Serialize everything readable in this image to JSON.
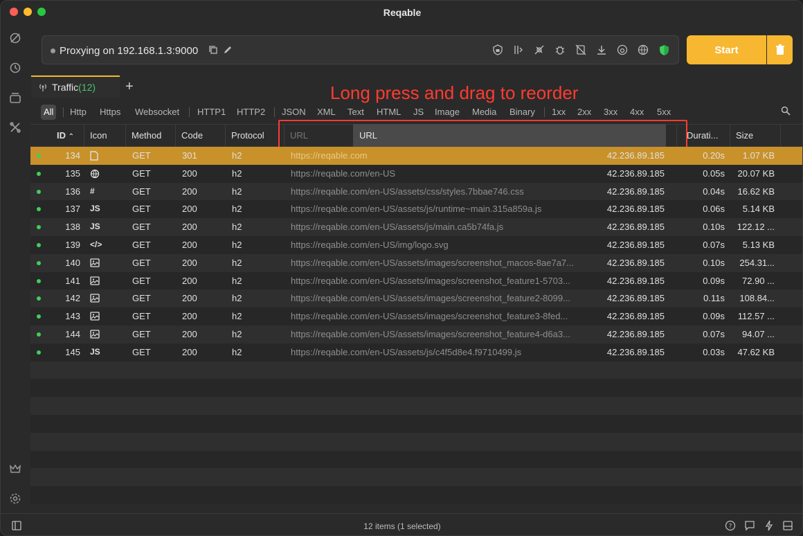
{
  "window": {
    "title": "Reqable"
  },
  "sidebar": {
    "icons": [
      "capture-icon",
      "history-icon",
      "collections-icon",
      "tools-icon",
      "crown-icon",
      "settings-icon"
    ]
  },
  "proxy": {
    "status_text": "Proxying on 192.168.1.3:9000",
    "start_label": "Start"
  },
  "tabs": [
    {
      "label": "Traffic",
      "count": "(12)"
    }
  ],
  "annotation": "Long press and drag to reorder",
  "filters": [
    "All",
    "Http",
    "Https",
    "Websocket",
    "HTTP1",
    "HTTP2",
    "JSON",
    "XML",
    "Text",
    "HTML",
    "JS",
    "Image",
    "Media",
    "Binary",
    "1xx",
    "2xx",
    "3xx",
    "4xx",
    "5xx"
  ],
  "columns": {
    "id": "ID",
    "icon": "Icon",
    "method": "Method",
    "code": "Code",
    "protocol": "Protocol",
    "url": "URL",
    "url_drag": "URL",
    "duration": "Durati...",
    "size": "Size"
  },
  "rows": [
    {
      "id": "134",
      "icon": "document",
      "method": "GET",
      "code": "301",
      "protocol": "h2",
      "url": "https://reqable.com",
      "host": "42.236.89.185",
      "duration": "0.20s",
      "size": "1.07 KB"
    },
    {
      "id": "135",
      "icon": "globe",
      "method": "GET",
      "code": "200",
      "protocol": "h2",
      "url": "https://reqable.com/en-US",
      "host": "42.236.89.185",
      "duration": "0.05s",
      "size": "20.07 KB"
    },
    {
      "id": "136",
      "icon": "#",
      "method": "GET",
      "code": "200",
      "protocol": "h2",
      "url": "https://reqable.com/en-US/assets/css/styles.7bbae746.css",
      "host": "42.236.89.185",
      "duration": "0.04s",
      "size": "16.62 KB"
    },
    {
      "id": "137",
      "icon": "JS",
      "method": "GET",
      "code": "200",
      "protocol": "h2",
      "url": "https://reqable.com/en-US/assets/js/runtime~main.315a859a.js",
      "host": "42.236.89.185",
      "duration": "0.06s",
      "size": "5.14 KB"
    },
    {
      "id": "138",
      "icon": "JS",
      "method": "GET",
      "code": "200",
      "protocol": "h2",
      "url": "https://reqable.com/en-US/assets/js/main.ca5b74fa.js",
      "host": "42.236.89.185",
      "duration": "0.10s",
      "size": "122.12 ..."
    },
    {
      "id": "139",
      "icon": "</>",
      "method": "GET",
      "code": "200",
      "protocol": "h2",
      "url": "https://reqable.com/en-US/img/logo.svg",
      "host": "42.236.89.185",
      "duration": "0.07s",
      "size": "5.13 KB"
    },
    {
      "id": "140",
      "icon": "image",
      "method": "GET",
      "code": "200",
      "protocol": "h2",
      "url": "https://reqable.com/en-US/assets/images/screenshot_macos-8ae7a7...",
      "host": "42.236.89.185",
      "duration": "0.10s",
      "size": "254.31..."
    },
    {
      "id": "141",
      "icon": "image",
      "method": "GET",
      "code": "200",
      "protocol": "h2",
      "url": "https://reqable.com/en-US/assets/images/screenshot_feature1-5703...",
      "host": "42.236.89.185",
      "duration": "0.09s",
      "size": "72.90 ..."
    },
    {
      "id": "142",
      "icon": "image",
      "method": "GET",
      "code": "200",
      "protocol": "h2",
      "url": "https://reqable.com/en-US/assets/images/screenshot_feature2-8099...",
      "host": "42.236.89.185",
      "duration": "0.11s",
      "size": "108.84..."
    },
    {
      "id": "143",
      "icon": "image",
      "method": "GET",
      "code": "200",
      "protocol": "h2",
      "url": "https://reqable.com/en-US/assets/images/screenshot_feature3-8fed...",
      "host": "42.236.89.185",
      "duration": "0.09s",
      "size": "112.57 ..."
    },
    {
      "id": "144",
      "icon": "image",
      "method": "GET",
      "code": "200",
      "protocol": "h2",
      "url": "https://reqable.com/en-US/assets/images/screenshot_feature4-d6a3...",
      "host": "42.236.89.185",
      "duration": "0.07s",
      "size": "94.07 ..."
    },
    {
      "id": "145",
      "icon": "JS",
      "method": "GET",
      "code": "200",
      "protocol": "h2",
      "url": "https://reqable.com/en-US/assets/js/c4f5d8e4.f9710499.js",
      "host": "42.236.89.185",
      "duration": "0.03s",
      "size": "47.62 KB"
    }
  ],
  "selected_row": "134",
  "status": {
    "text": "12 items (1 selected)"
  },
  "colors": {
    "accent": "#f7b731",
    "selected_row": "#c8912a",
    "status_dot": "#3fcf5c",
    "annotation": "#ff3b30"
  }
}
